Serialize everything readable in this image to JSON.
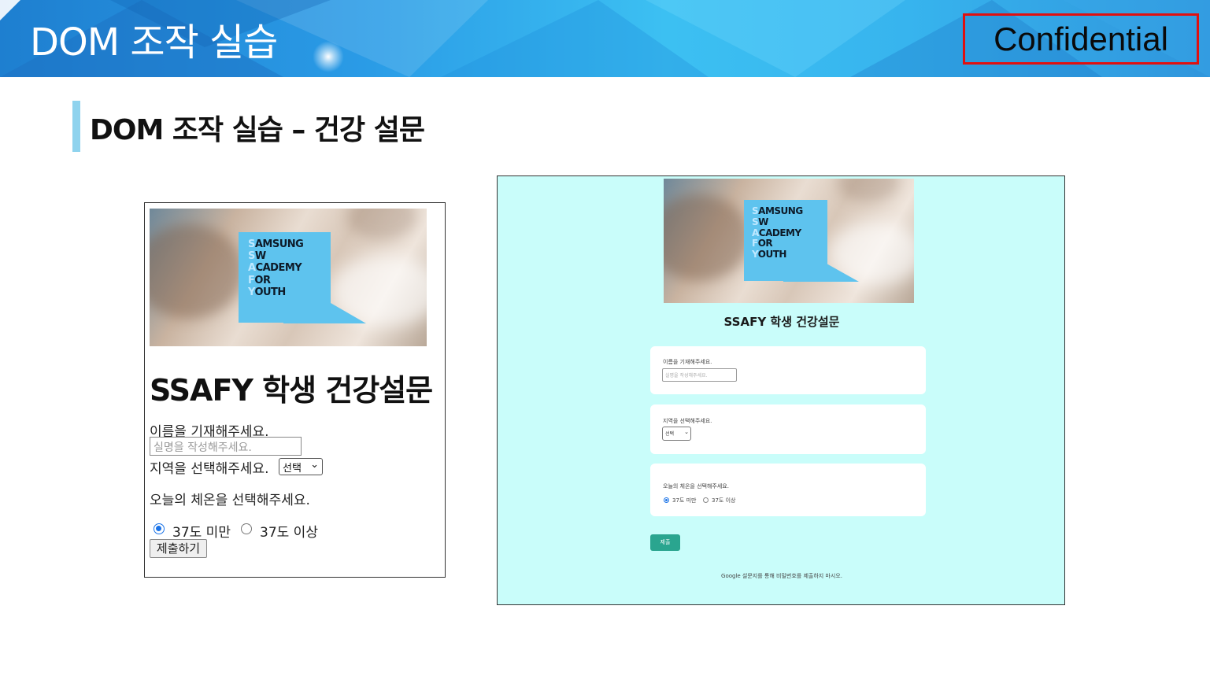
{
  "slide": {
    "title": "DOM 조작 실습",
    "confidential": "Confidential",
    "section_title": "DOM 조작 실습 – 건강 설문"
  },
  "logo": {
    "lines": [
      {
        "first": "S",
        "rest": "AMSUNG"
      },
      {
        "first": "S",
        "rest": "W"
      },
      {
        "first": "A",
        "rest": "CADEMY"
      },
      {
        "first": "F",
        "rest": "OR"
      },
      {
        "first": "Y",
        "rest": "OUTH"
      }
    ]
  },
  "left_form": {
    "title": "SSAFY 학생 건강설문",
    "name_label": "이름을 기재해주세요.",
    "name_placeholder": "실명을 작성해주세요.",
    "region_label": "지역을 선택해주세요.",
    "region_select": "선택",
    "temp_label": "오늘의 체온을 선택해주세요.",
    "option_below": "37도 미만",
    "option_above": "37도 이상",
    "submit": "제출하기"
  },
  "right_form": {
    "title": "SSAFY 학생 건강설문",
    "name_label": "이름을 기재해주세요.",
    "name_placeholder": "실명을 작성해주세요.",
    "region_label": "지역을 선택해주세요.",
    "region_select": "선택",
    "temp_label": "오늘의 체온을 선택해주세요.",
    "option_below": "37도 미만",
    "option_above": "37도 이상",
    "submit": "제출",
    "footer": "Google 설문지를 통해 비밀번호를 제출하지 마시오."
  },
  "colors": {
    "banner_blue": "#2a9be6",
    "confidential_border": "#e01010",
    "right_bg": "#c9fdfa",
    "submit_green": "#2aa58f",
    "logo_blue": "#5ec3ee"
  }
}
